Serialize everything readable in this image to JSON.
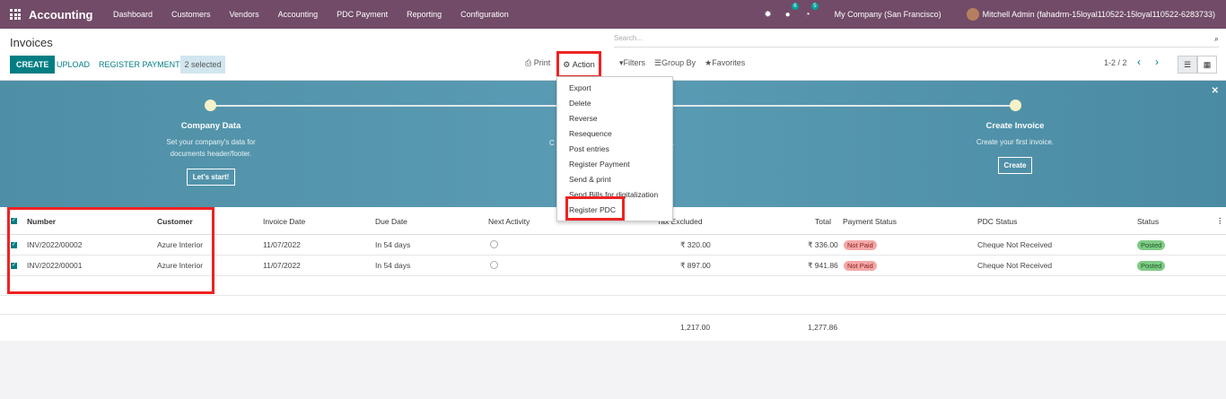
{
  "navbar": {
    "brand": "Accounting",
    "menu": [
      "Dashboard",
      "Customers",
      "Vendors",
      "Accounting",
      "PDC Payment",
      "Reporting",
      "Configuration"
    ],
    "chat_badge": "6",
    "activity_badge": "5",
    "company": "My Company (San Francisco)",
    "user": "Mitchell Admin (fahadrm-15loyal110522-15loyal110522-6283733)"
  },
  "control_panel": {
    "title": "Invoices",
    "create_label": "CREATE",
    "upload_label": "UPLOAD",
    "register_payment_label": "REGISTER PAYMENT",
    "selected_label": "2 selected",
    "print_label": "Print",
    "action_label": "Action",
    "search_placeholder": "Search...",
    "filters_label": "Filters",
    "groupby_label": "Group By",
    "favorites_label": "Favorites",
    "pager": "1-2 / 2"
  },
  "action_menu": [
    "Export",
    "Delete",
    "Reverse",
    "Resequence",
    "Post entries",
    "Register Payment",
    "Send & print",
    "Send Bills for digitalization",
    "Register PDC"
  ],
  "banner": {
    "step1_title": "Company Data",
    "step1_desc1": "Set your company's data for",
    "step1_desc2": "documents header/footer.",
    "step1_button": "Let's start!",
    "step2_title_fragment": "C",
    "step2_desc_fragment": ".",
    "step3_title": "Create Invoice",
    "step3_desc": "Create your first invoice.",
    "step3_button": "Create"
  },
  "table": {
    "headers": {
      "number": "Number",
      "customer": "Customer",
      "invoice_date": "Invoice Date",
      "due_date": "Due Date",
      "next_activity": "Next Activity",
      "tax_excluded": "Tax Excluded",
      "total": "Total",
      "payment_status": "Payment Status",
      "pdc_status": "PDC Status",
      "status": "Status"
    },
    "rows": [
      {
        "number": "INV/2022/00002",
        "customer": "Azure Interior",
        "invoice_date": "11/07/2022",
        "due_date": "In 54 days",
        "tax_excluded": "₹ 320.00",
        "total": "₹ 336.00",
        "payment_status": "Not Paid",
        "pdc_status": "Cheque Not Received",
        "status": "Posted"
      },
      {
        "number": "INV/2022/00001",
        "customer": "Azure Interior",
        "invoice_date": "11/07/2022",
        "due_date": "In 54 days",
        "tax_excluded": "₹ 897.00",
        "total": "₹ 941.86",
        "payment_status": "Not Paid",
        "pdc_status": "Cheque Not Received",
        "status": "Posted"
      }
    ],
    "sum_tax_excluded": "1,217.00",
    "sum_total": "1,277.86"
  }
}
